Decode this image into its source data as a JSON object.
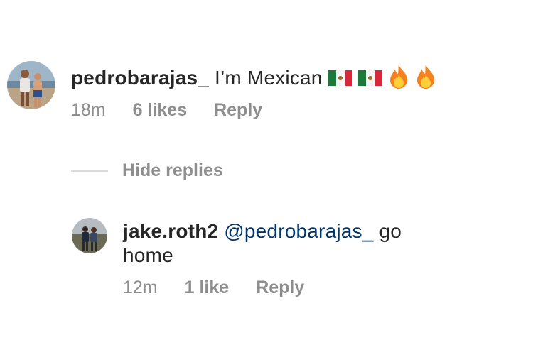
{
  "comment1": {
    "username": "pedrobarajas_",
    "text": "I’m Mexican",
    "emoji": [
      "flag-mexico",
      "flag-mexico",
      "fire",
      "fire"
    ],
    "time": "18m",
    "likes": "6 likes",
    "reply": "Reply"
  },
  "hide_replies": {
    "label": "Hide replies"
  },
  "reply1": {
    "username": "jake.roth2",
    "mention": "@pedrobarajas_",
    "text_after_mention": "go",
    "text_line2": "home",
    "time": "12m",
    "likes": "1 like",
    "reply": "Reply"
  },
  "colors": {
    "text": "#262626",
    "meta": "#8e8e8e",
    "mention": "#003569",
    "divider": "#dbdbdb"
  }
}
